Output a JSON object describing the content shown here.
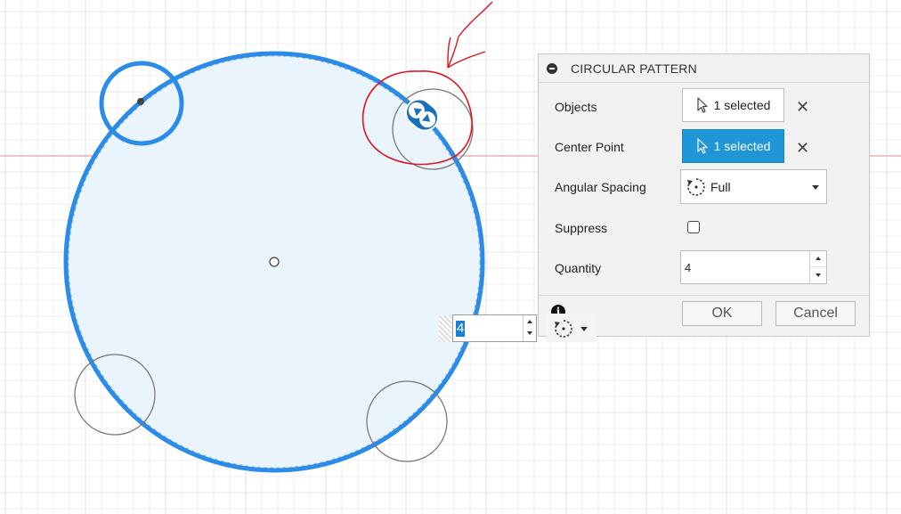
{
  "dialog": {
    "title": "CIRCULAR PATTERN",
    "objects_label": "Objects",
    "objects_value": "1 selected",
    "center_point_label": "Center Point",
    "center_point_value": "1 selected",
    "angular_spacing_label": "Angular Spacing",
    "angular_spacing_value": "Full",
    "suppress_label": "Suppress",
    "suppress_checked": false,
    "quantity_label": "Quantity",
    "quantity_value": "4",
    "ok_label": "OK",
    "cancel_label": "Cancel",
    "info_glyph": "i",
    "clear_glyph": "✕"
  },
  "canvas": {
    "quantity_spinner_value": "4",
    "accent_color": "#2a8be8",
    "selection_fill": "#eaf4fd",
    "axis_color": "#e8a0a8",
    "grid_color": "#e4e4e4",
    "annotation_color": "#e0141e"
  },
  "icons": {
    "collapse": "collapse-icon",
    "cursor": "cursor-arrow-icon",
    "rotate": "rotate-icon",
    "clear": "close-icon",
    "info": "info-icon",
    "manipulator": "move-handle-icon"
  }
}
